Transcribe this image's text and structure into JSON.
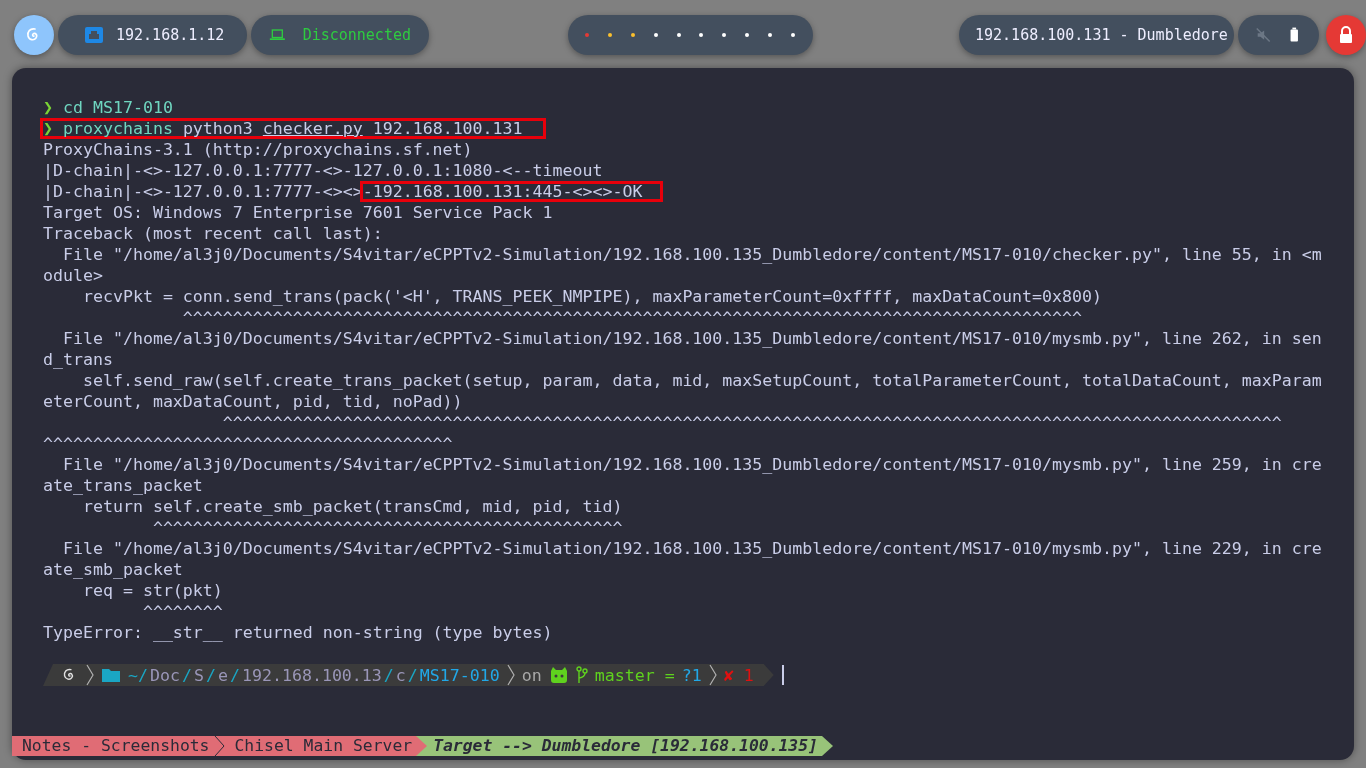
{
  "top_bar": {
    "host_ip": "192.168.1.12",
    "vpn_status": "Disconnected",
    "workspaces": [
      {
        "color": "#e53935"
      },
      {
        "color": "#fbc02d"
      },
      {
        "color": "#fbc02d"
      },
      {
        "color": "#ffffff"
      },
      {
        "color": "#ffffff"
      },
      {
        "color": "#ffffff"
      },
      {
        "color": "#ffffff"
      },
      {
        "color": "#ffffff"
      },
      {
        "color": "#ffffff"
      },
      {
        "color": "#ffffff"
      }
    ],
    "target": "192.168.100.131 - Dumbledore",
    "muted": true
  },
  "terminal": {
    "lines": [
      {
        "segments": [
          {
            "text": "❯",
            "kind": "arrow"
          },
          {
            "text": " cd MS17-010",
            "kind": "command"
          }
        ]
      },
      {
        "boxed": true,
        "segments": [
          {
            "text": "❯",
            "kind": "arrow"
          },
          {
            "text": " proxychains",
            "kind": "command"
          },
          {
            "text": " python3 ",
            "kind": "plain"
          },
          {
            "text": "checker.py",
            "kind": "file"
          },
          {
            "text": " 192.168.100.131",
            "kind": "plain"
          }
        ]
      },
      {
        "segments": [
          {
            "text": "ProxyChains-3.1 (http://proxychains.sf.net)",
            "kind": "plain"
          }
        ]
      },
      {
        "segments": [
          {
            "text": "|D-chain|-<>-127.0.0.1:7777-<>-127.0.0.1:1080-<--timeout",
            "kind": "plain"
          }
        ]
      },
      {
        "segments": [
          {
            "text": "|D-chain|-<>-127.0.0.1:7777-<><>",
            "kind": "plain"
          },
          {
            "text": "-192.168.100.131:445-<><>-OK",
            "kind": "plain",
            "boxed": true
          }
        ]
      },
      {
        "segments": [
          {
            "text": "Target OS: Windows 7 Enterprise 7601 Service Pack 1",
            "kind": "plain"
          }
        ]
      },
      {
        "segments": [
          {
            "text": "Traceback (most recent call last):",
            "kind": "plain"
          }
        ]
      },
      {
        "segments": [
          {
            "text": "  File \"/home/al3j0/Documents/S4vitar/eCPPTv2-Simulation/192.168.100.135_Dumbledore/content/MS17-010/checker.py\", line 55, in <m",
            "kind": "plain"
          }
        ]
      },
      {
        "segments": [
          {
            "text": "odule>",
            "kind": "plain"
          }
        ]
      },
      {
        "segments": [
          {
            "text": "    recvPkt = conn.send_trans(pack('<H', TRANS_PEEK_NMPIPE), maxParameterCount=0xffff, maxDataCount=0x800)",
            "kind": "plain"
          }
        ]
      },
      {
        "segments": [
          {
            "text": "              ^^^^^^^^^^^^^^^^^^^^^^^^^^^^^^^^^^^^^^^^^^^^^^^^^^^^^^^^^^^^^^^^^^^^^^^^^^^^^^^^^^^^^^^^^^",
            "kind": "plain"
          }
        ]
      },
      {
        "segments": [
          {
            "text": "  File \"/home/al3j0/Documents/S4vitar/eCPPTv2-Simulation/192.168.100.135_Dumbledore/content/MS17-010/mysmb.py\", line 262, in sen",
            "kind": "plain"
          }
        ]
      },
      {
        "segments": [
          {
            "text": "d_trans",
            "kind": "plain"
          }
        ]
      },
      {
        "segments": [
          {
            "text": "    self.send_raw(self.create_trans_packet(setup, param, data, mid, maxSetupCount, totalParameterCount, totalDataCount, maxParam",
            "kind": "plain"
          }
        ]
      },
      {
        "segments": [
          {
            "text": "eterCount, maxDataCount, pid, tid, noPad))",
            "kind": "plain"
          }
        ]
      },
      {
        "segments": [
          {
            "text": "                  ^^^^^^^^^^^^^^^^^^^^^^^^^^^^^^^^^^^^^^^^^^^^^^^^^^^^^^^^^^^^^^^^^^^^^^^^^^^^^^^^^^^^^^^^^^^^^^^^^^^^^^^^^^",
            "kind": "plain"
          }
        ]
      },
      {
        "segments": [
          {
            "text": "^^^^^^^^^^^^^^^^^^^^^^^^^^^^^^^^^^^^^^^^^",
            "kind": "plain"
          }
        ]
      },
      {
        "segments": [
          {
            "text": "  File \"/home/al3j0/Documents/S4vitar/eCPPTv2-Simulation/192.168.100.135_Dumbledore/content/MS17-010/mysmb.py\", line 259, in cre",
            "kind": "plain"
          }
        ]
      },
      {
        "segments": [
          {
            "text": "ate_trans_packet",
            "kind": "plain"
          }
        ]
      },
      {
        "segments": [
          {
            "text": "    return self.create_smb_packet(transCmd, mid, pid, tid)",
            "kind": "plain"
          }
        ]
      },
      {
        "segments": [
          {
            "text": "           ^^^^^^^^^^^^^^^^^^^^^^^^^^^^^^^^^^^^^^^^^^^^^^^",
            "kind": "plain"
          }
        ]
      },
      {
        "segments": [
          {
            "text": "  File \"/home/al3j0/Documents/S4vitar/eCPPTv2-Simulation/192.168.100.135_Dumbledore/content/MS17-010/mysmb.py\", line 229, in cre",
            "kind": "plain"
          }
        ]
      },
      {
        "segments": [
          {
            "text": "ate_smb_packet",
            "kind": "plain"
          }
        ]
      },
      {
        "segments": [
          {
            "text": "    req = str(pkt)",
            "kind": "plain"
          }
        ]
      },
      {
        "segments": [
          {
            "text": "          ^^^^^^^^",
            "kind": "plain"
          }
        ]
      },
      {
        "segments": [
          {
            "text": "TypeError: __str__ returned non-string (type bytes)",
            "kind": "plain"
          }
        ]
      }
    ],
    "prompt": {
      "path": [
        {
          "text": "~/",
          "kind": "separator"
        },
        {
          "text": "Doc",
          "kind": "dir"
        },
        {
          "text": "/",
          "kind": "separator"
        },
        {
          "text": "S",
          "kind": "dir"
        },
        {
          "text": "/",
          "kind": "separator"
        },
        {
          "text": "e",
          "kind": "dir"
        },
        {
          "text": "/",
          "kind": "separator"
        },
        {
          "text": "192.168.100.13",
          "kind": "dir"
        },
        {
          "text": "/",
          "kind": "separator"
        },
        {
          "text": "c",
          "kind": "dir"
        },
        {
          "text": "/",
          "kind": "separator"
        },
        {
          "text": "MS17-010",
          "kind": "current"
        }
      ],
      "on": "on",
      "branch": "master =",
      "git_status": "?1",
      "exit_status": "✘ 1"
    },
    "tmux": [
      {
        "text": "Notes - Screenshots",
        "kind": "window"
      },
      {
        "text": "Chisel Main Server",
        "kind": "window"
      },
      {
        "text": "Target --> Dumbledore [192.168.100.135]",
        "kind": "target"
      }
    ]
  }
}
